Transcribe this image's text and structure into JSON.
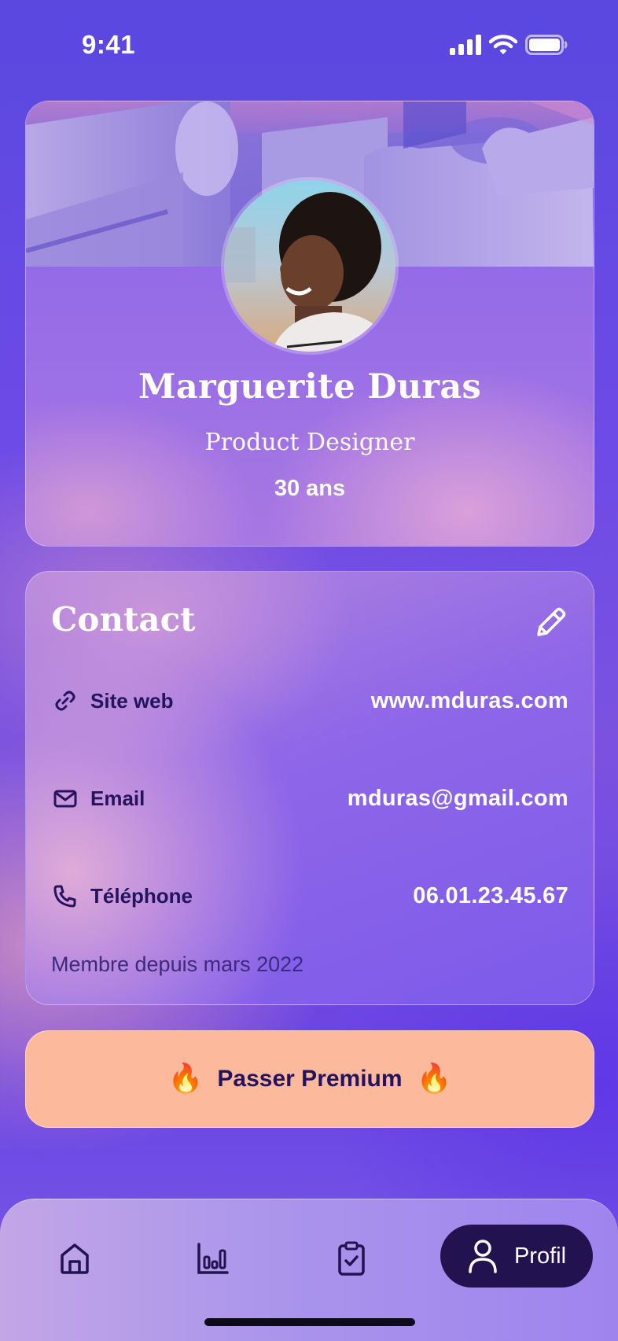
{
  "status_bar": {
    "time": "9:41"
  },
  "profile": {
    "name": "Marguerite Duras",
    "role": "Product Designer",
    "age": "30 ans"
  },
  "contact": {
    "title": "Contact",
    "rows": [
      {
        "icon": "link-icon",
        "label": "Site web",
        "value": "www.mduras.com"
      },
      {
        "icon": "mail-icon",
        "label": "Email",
        "value": "mduras@gmail.com"
      },
      {
        "icon": "phone-icon",
        "label": "Téléphone",
        "value": "06.01.23.45.67"
      }
    ],
    "member_since": "Membre depuis mars 2022"
  },
  "premium": {
    "label": "Passer Premium",
    "emoji": "🔥"
  },
  "tabbar": {
    "items": [
      {
        "icon": "home-icon"
      },
      {
        "icon": "chart-icon"
      },
      {
        "icon": "clipboard-check-icon"
      },
      {
        "icon": "user-icon",
        "label": "Profil",
        "active": true
      }
    ]
  },
  "colors": {
    "accent_dark": "#221250",
    "premium_bg": "#fdb99c",
    "label_text": "#241460"
  }
}
